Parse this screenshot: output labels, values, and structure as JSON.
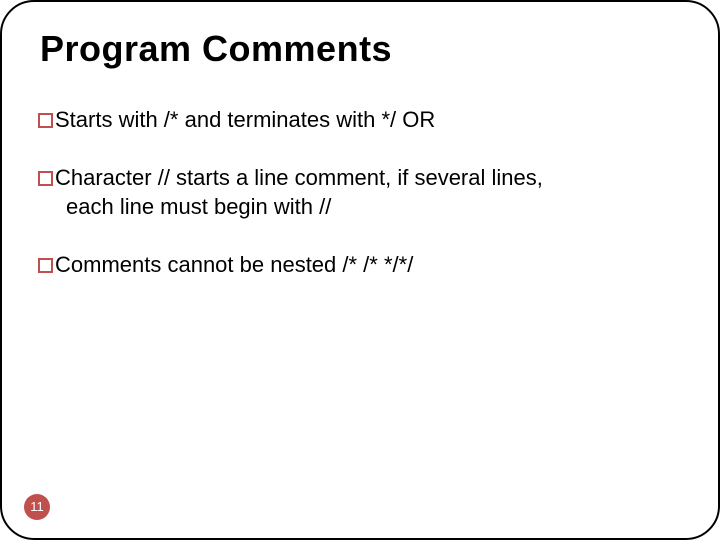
{
  "title": "Program Comments",
  "bullets": [
    {
      "first": "Starts with /*  and terminates with */ OR",
      "cont": ""
    },
    {
      "first": "Character // starts a line comment, if several lines,",
      "cont": "each line must begin with //"
    },
    {
      "first": "Comments cannot be nested /* /* */*/",
      "cont": ""
    }
  ],
  "page_number": "11"
}
